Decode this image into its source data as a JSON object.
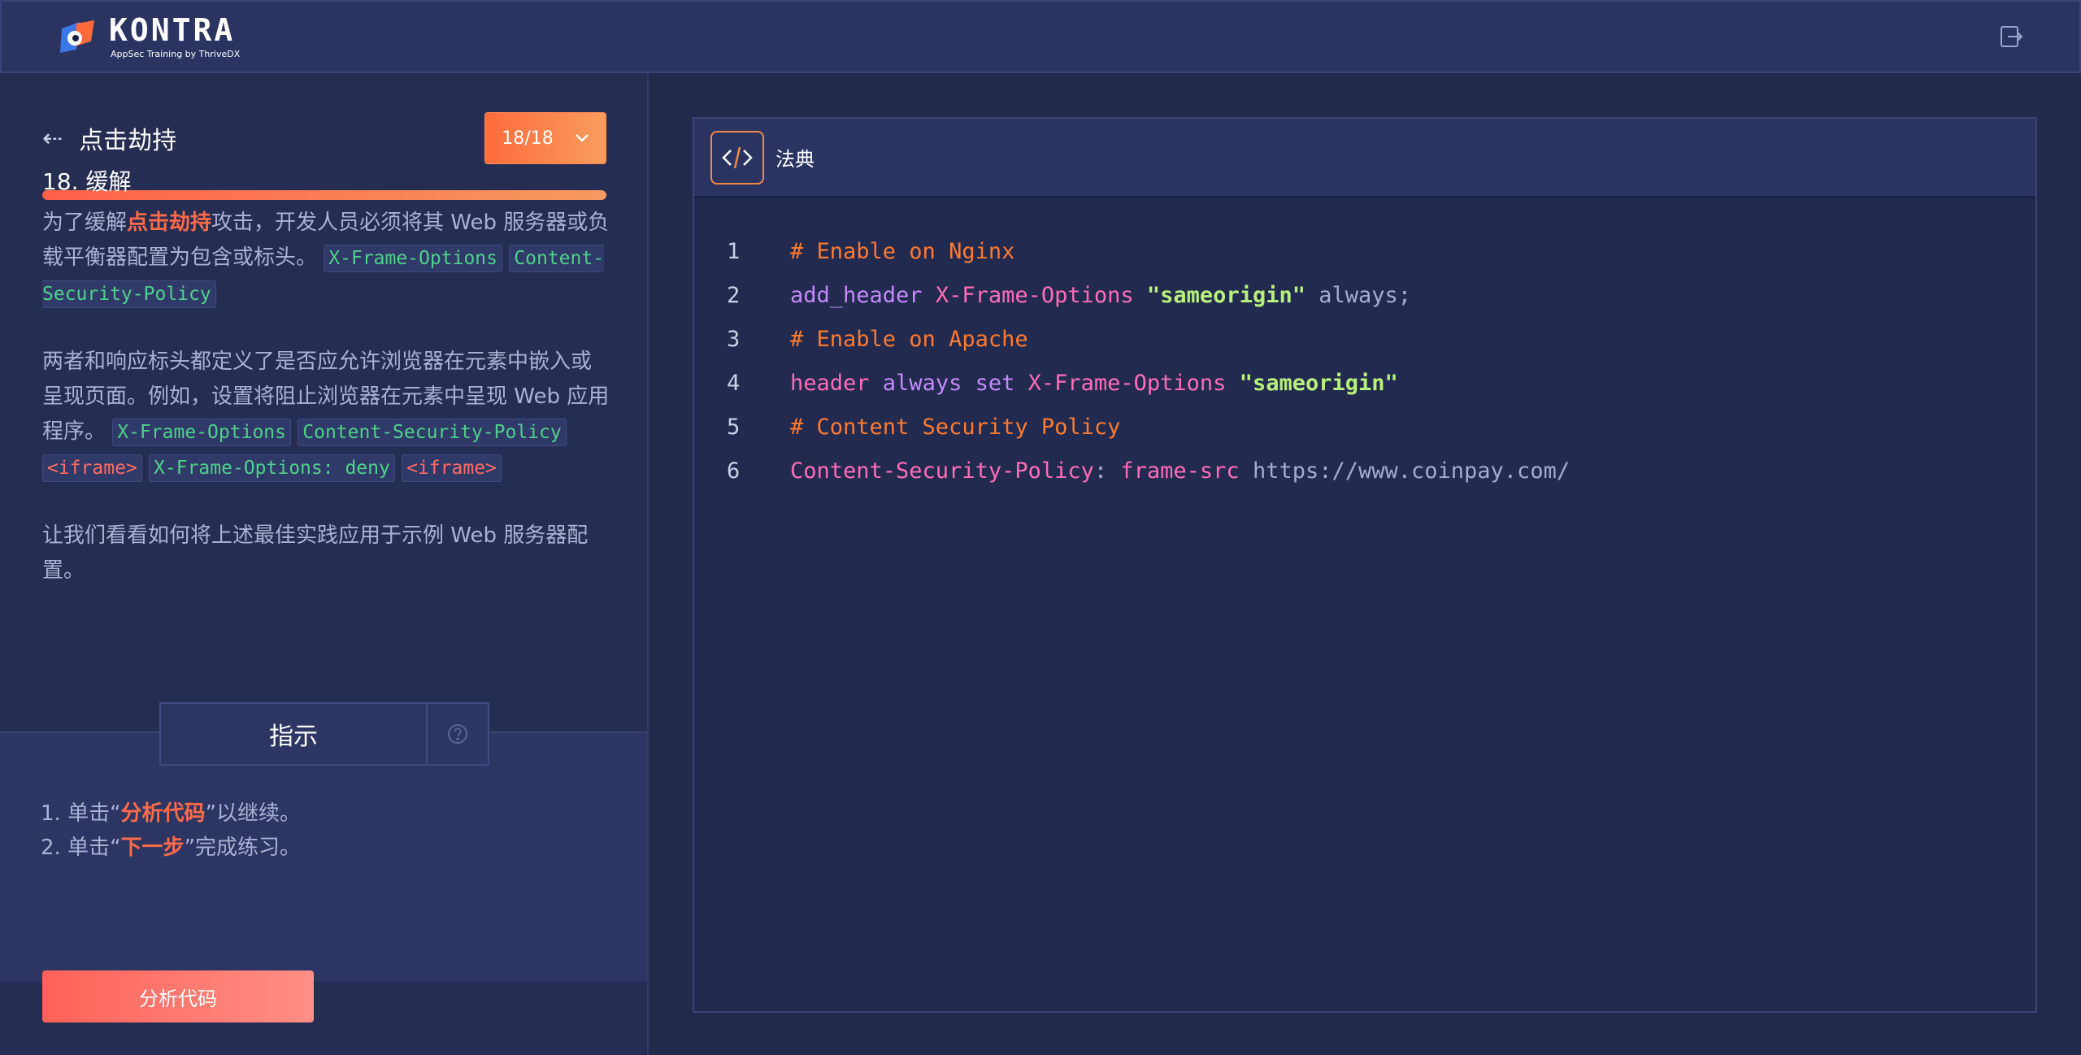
{
  "brand": {
    "name": "KONTRA",
    "tagline": "AppSec Training by ThriveDX"
  },
  "lesson": {
    "title": "点击劫持",
    "step_label": "18/18",
    "progress": 1.0
  },
  "content": {
    "heading": "18. 缓解",
    "p1": {
      "t1": "为了缓解",
      "highlight": "点击劫持",
      "t2": "攻击，开发人员必须将其 Web 服务器或负载平衡器配置为包含或标头。",
      "code1": "X-Frame-Options",
      "code2": "Content-Security-Policy"
    },
    "p2": {
      "t1": "两者和响应标头都定义了是否应允许浏览器在元素中嵌入或呈现页面。例如，设置将阻止浏览器在元素中呈现 Web 应用程序。",
      "code1": "X-Frame-Options",
      "code2": "Content-Security-Policy",
      "code3": "<iframe>",
      "code4": "X-Frame-Options: deny",
      "code5": "<iframe>"
    },
    "p3": "让我们看看如何将上述最佳实践应用于示例 Web 服务器配置。"
  },
  "instructions": {
    "tab_label": "指示",
    "line1_pre": "1. 单击“",
    "line1_hl": "分析代码",
    "line1_post": "”以继续。",
    "line2_pre": "2. 单击“",
    "line2_hl": "下一步",
    "line2_post": "”完成练习。",
    "button_label": "分析代码"
  },
  "code_panel": {
    "title": "法典",
    "lines": [
      {
        "num": "1",
        "parts": [
          {
            "cls": "c-comment",
            "text": "# Enable on Nginx"
          }
        ]
      },
      {
        "num": "2",
        "parts": [
          {
            "cls": "c-purple",
            "text": "add_header "
          },
          {
            "cls": "c-pink",
            "text": "X-Frame-Options "
          },
          {
            "cls": "c-string",
            "text": "\"sameorigin\""
          },
          {
            "cls": "c-plain",
            "text": " always;"
          }
        ]
      },
      {
        "num": "3",
        "parts": [
          {
            "cls": "c-comment",
            "text": "# Enable on Apache"
          }
        ]
      },
      {
        "num": "4",
        "parts": [
          {
            "cls": "c-pink",
            "text": "header "
          },
          {
            "cls": "c-purple",
            "text": "always set "
          },
          {
            "cls": "c-pink",
            "text": "X-Frame-Options "
          },
          {
            "cls": "c-string",
            "text": "\"sameorigin\""
          }
        ]
      },
      {
        "num": "5",
        "parts": [
          {
            "cls": "c-comment",
            "text": "# Content Security Policy"
          }
        ]
      },
      {
        "num": "6",
        "parts": [
          {
            "cls": "c-pink",
            "text": "Content-Security-Policy"
          },
          {
            "cls": "c-plain",
            "text": ": "
          },
          {
            "cls": "c-pink",
            "text": "frame-src "
          },
          {
            "cls": "c-plain",
            "text": "https://www.coinpay.com/"
          }
        ]
      }
    ]
  },
  "icons": {
    "logo": "kontra-logo-icon",
    "exit": "exit-icon",
    "back": "back-arrow-icon",
    "chevron": "chevron-down-icon",
    "help": "help-icon",
    "code": "code-icon"
  },
  "colors": {
    "accent": "#ff6b3d",
    "highlight": "#ff6a48",
    "code_green": "#4fd18b",
    "code_red": "#ff6b60"
  }
}
